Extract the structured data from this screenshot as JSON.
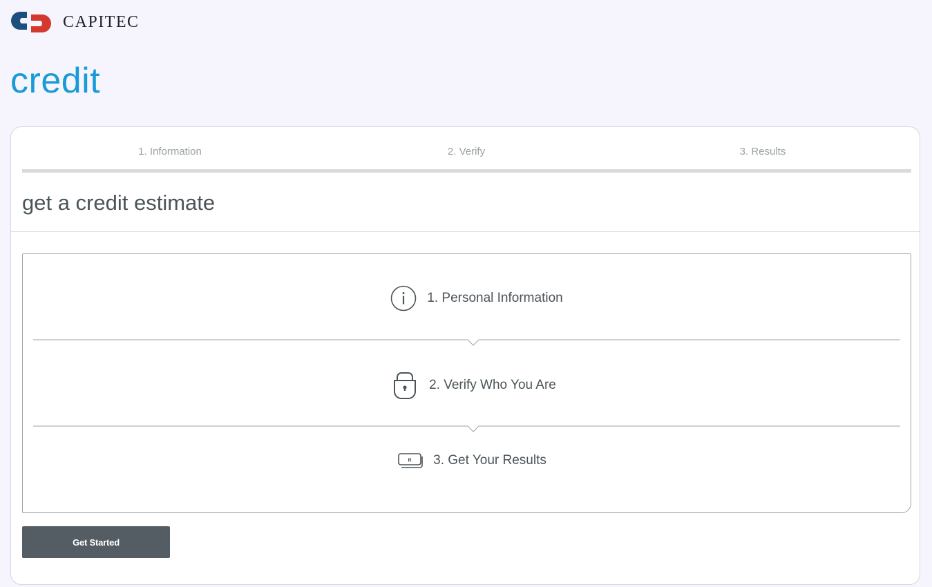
{
  "brand": {
    "name": "CAPITEC",
    "colors": {
      "red": "#d3392f",
      "navy": "#1c4f7c",
      "accent": "#1a9ad6"
    }
  },
  "page": {
    "title": "credit"
  },
  "progress_steps": [
    {
      "label": "1. Information"
    },
    {
      "label": "2. Verify"
    },
    {
      "label": "3. Results"
    }
  ],
  "card": {
    "heading": "get a credit estimate",
    "items": [
      {
        "label": "1. Personal Information",
        "icon": "info-circle-icon"
      },
      {
        "label": "2. Verify Who You Are",
        "icon": "padlock-icon"
      },
      {
        "label": "3. Get Your Results",
        "icon": "banknotes-icon"
      }
    ],
    "button_label": "Get Started",
    "banknote_symbol": "R"
  }
}
